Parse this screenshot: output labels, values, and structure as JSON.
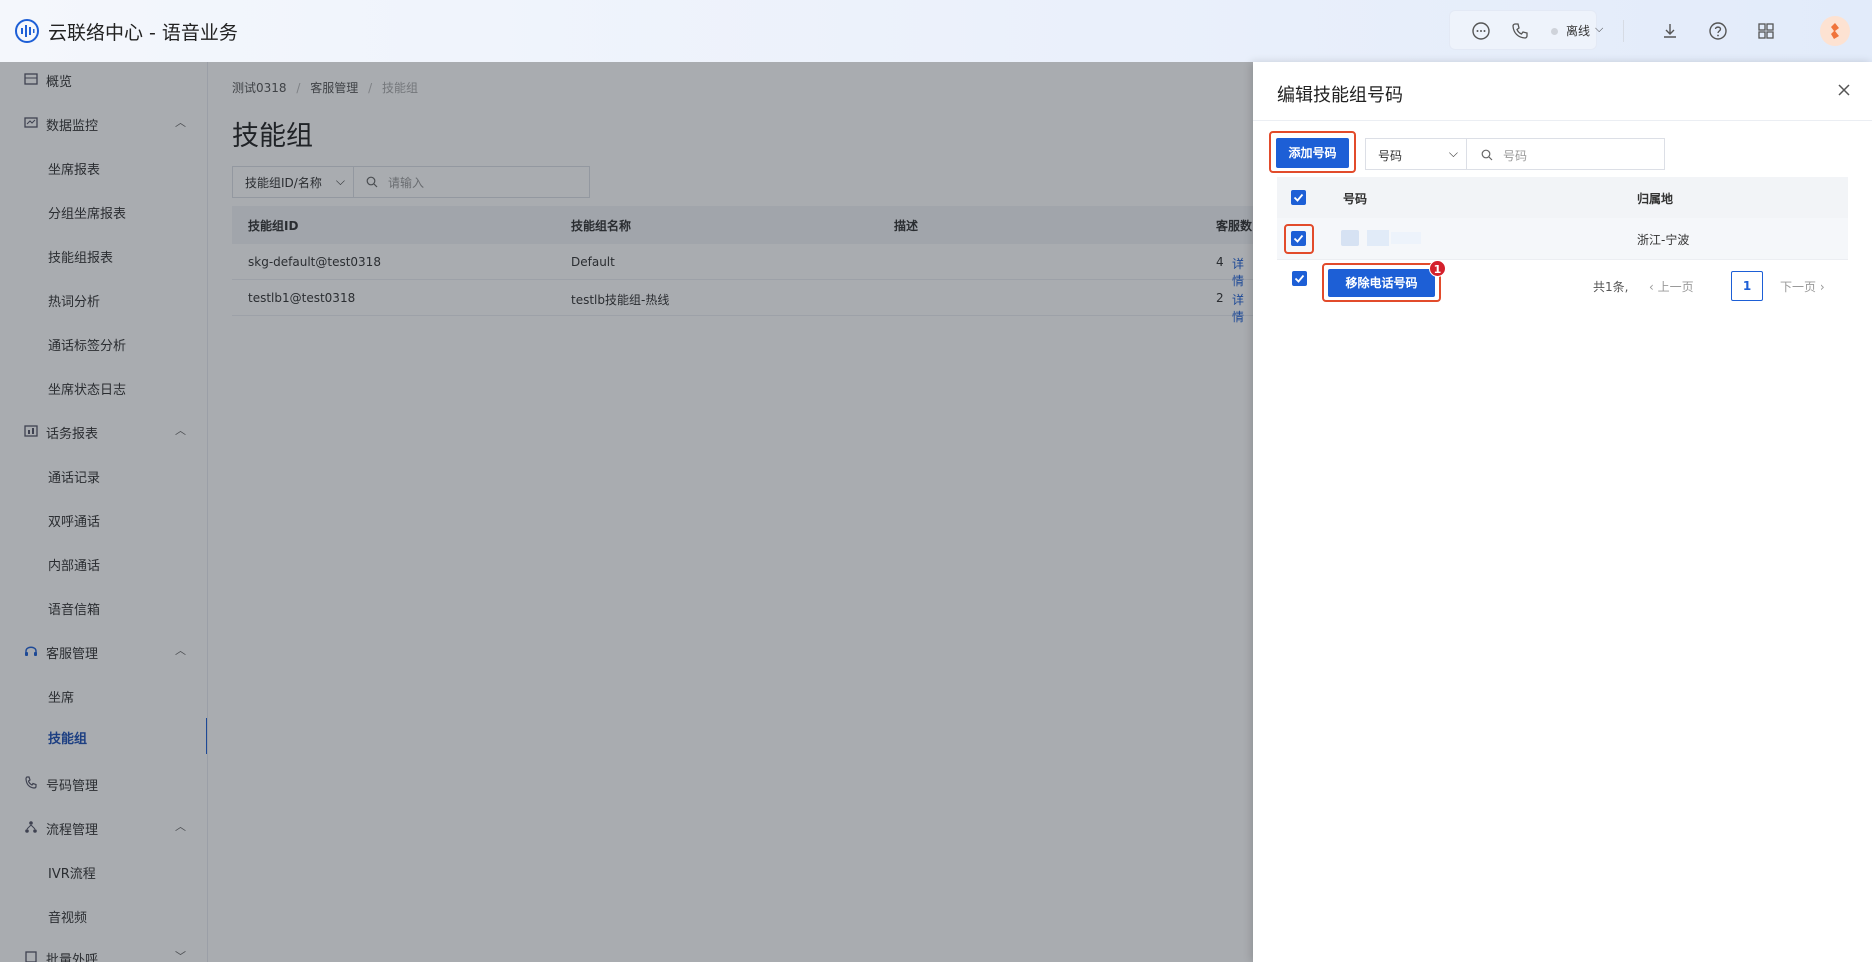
{
  "header": {
    "title": "云联络中心 - 语音业务",
    "status": "离线",
    "status_chevron": "⌵"
  },
  "sidebar": {
    "items": [
      {
        "label": "概览",
        "icon": "overview-icon",
        "level": 1
      },
      {
        "label": "数据监控",
        "icon": "monitor-icon",
        "level": 1,
        "expanded": true
      },
      {
        "label": "坐席报表",
        "level": 2
      },
      {
        "label": "分组坐席报表",
        "level": 2
      },
      {
        "label": "技能组报表",
        "level": 2
      },
      {
        "label": "热词分析",
        "level": 2
      },
      {
        "label": "通话标签分析",
        "level": 2
      },
      {
        "label": "坐席状态日志",
        "level": 2
      },
      {
        "label": "话务报表",
        "icon": "report-icon",
        "level": 1,
        "expanded": true
      },
      {
        "label": "通话记录",
        "level": 2
      },
      {
        "label": "双呼通话",
        "level": 2
      },
      {
        "label": "内部通话",
        "level": 2
      },
      {
        "label": "语音信箱",
        "level": 2
      },
      {
        "label": "客服管理",
        "icon": "headset-icon",
        "level": 1,
        "expanded": true
      },
      {
        "label": "坐席",
        "level": 2
      },
      {
        "label": "技能组",
        "level": 2,
        "active": true
      },
      {
        "label": "号码管理",
        "icon": "phone-icon",
        "level": 1
      },
      {
        "label": "流程管理",
        "icon": "flow-icon",
        "level": 1,
        "expanded": true
      },
      {
        "label": "IVR流程",
        "level": 2
      },
      {
        "label": "音视频",
        "level": 2
      },
      {
        "label": "批量外呼",
        "icon": "batch-icon",
        "level": 1
      }
    ]
  },
  "main": {
    "breadcrumb": [
      "测试0318",
      "客服管理",
      "技能组"
    ],
    "breadcrumb_sep": "/",
    "title": "技能组",
    "filter": {
      "select_value": "技能组ID/名称",
      "placeholder": "请输入"
    },
    "table": {
      "columns": [
        "技能组ID",
        "技能组名称",
        "描述",
        "客服数"
      ],
      "rows": [
        {
          "id": "skg-default@test0318",
          "name": "Default",
          "desc": "",
          "count": "4",
          "link": "详情"
        },
        {
          "id": "testlb1@test0318",
          "name": "testlb技能组-热线",
          "desc": "",
          "count": "2",
          "link": "详情"
        }
      ]
    }
  },
  "drawer": {
    "title": "编辑技能组号码",
    "add_button": "添加号码",
    "search": {
      "select_value": "号码",
      "placeholder": "号码"
    },
    "table": {
      "columns": [
        "号码",
        "归属地"
      ],
      "rows": [
        {
          "number": "",
          "location": "浙江-宁波",
          "checked": true
        }
      ]
    },
    "remove_button": "移除电话号码",
    "selected_count": "1",
    "pagination": {
      "total": "共1条,",
      "prev": "上一页",
      "current": "1",
      "next": "下一页"
    }
  },
  "colors": {
    "primary": "#1d5fd6",
    "highlight": "#e24b2b",
    "badge": "#d4202c",
    "overlay": "rgba(30,36,48,0.38)"
  }
}
